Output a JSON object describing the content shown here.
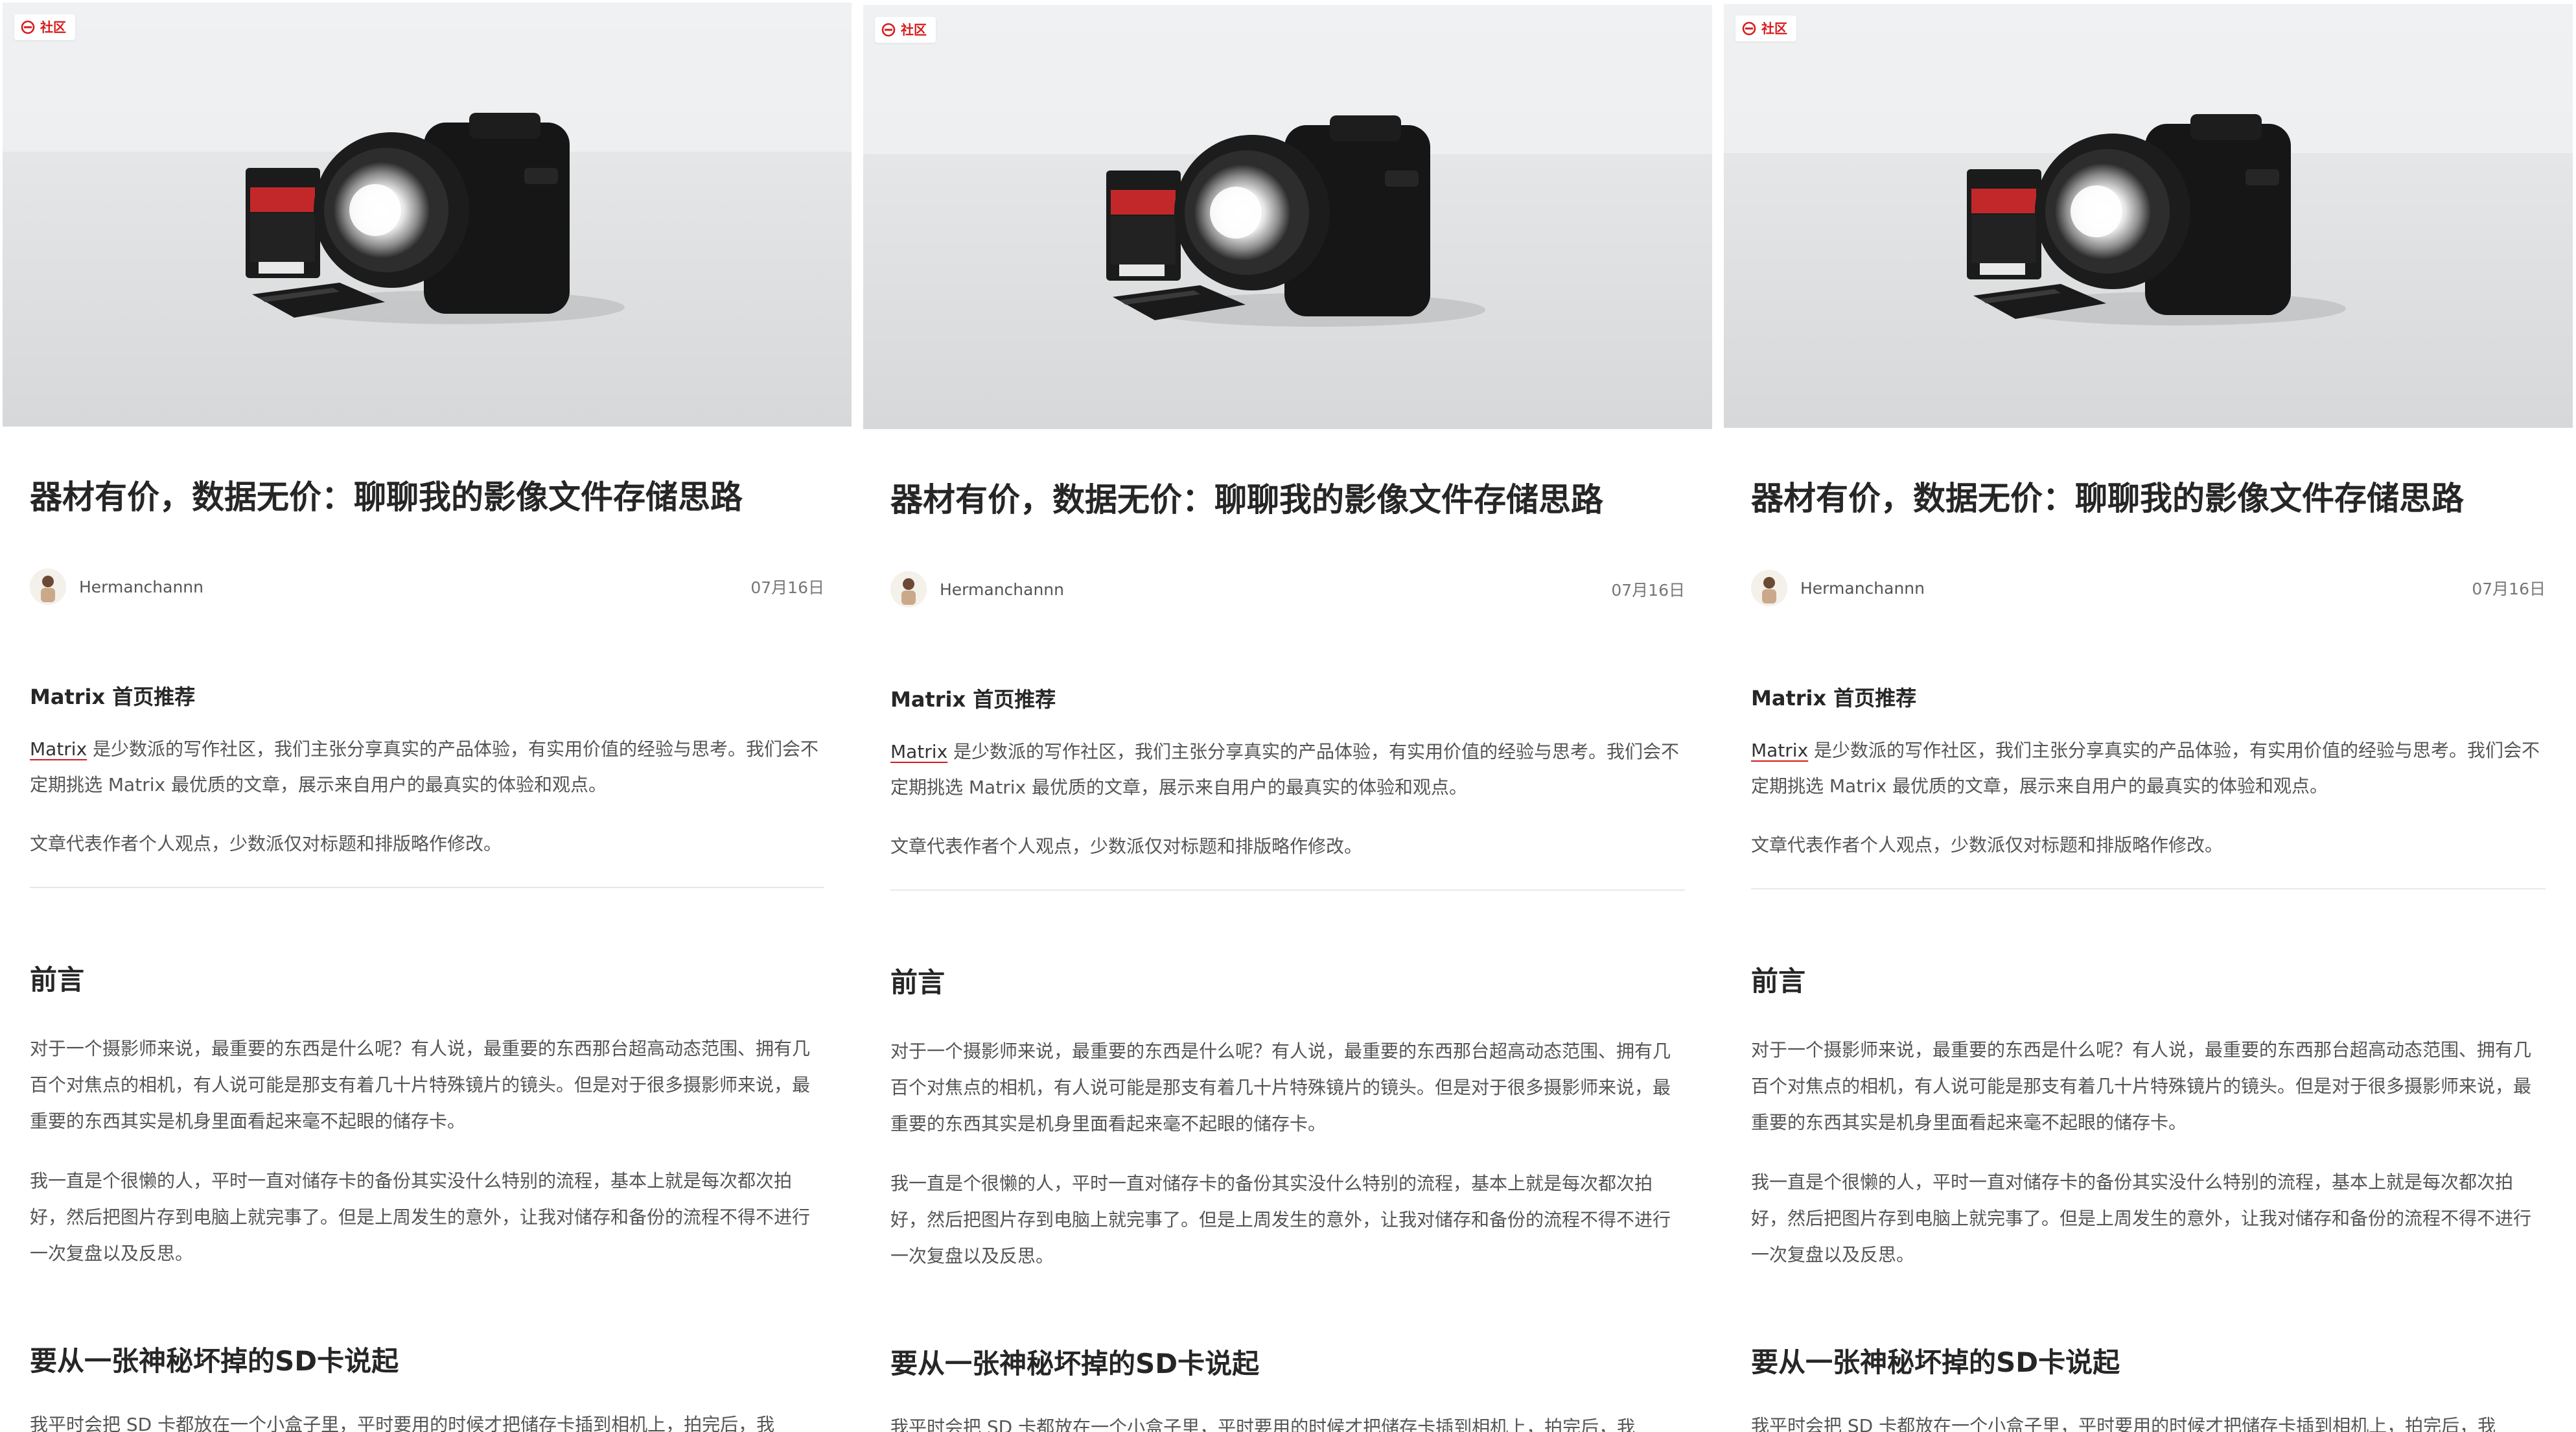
{
  "colors": {
    "accent": "#d71a1b",
    "text_dark": "#262626",
    "text_body": "#555555",
    "divider": "#e8e8e8"
  },
  "panels": [
    {
      "badge": "社区",
      "badge_icon": "sspai-logo-icon",
      "title": "器材有价，数据无价：聊聊我的影像文件存储思路",
      "author": "Hermanchannn",
      "date": "07月16日",
      "rec_heading": "Matrix 首页推荐",
      "rec_link": "Matrix",
      "rec_text": " 是少数派的写作社区，我们主张分享真实的产品体验，有实用价值的经验与思考。我们会不定期挑选 Matrix 最优质的文章，展示来自用户的最真实的体验和观点。",
      "rec_note": "文章代表作者个人观点，少数派仅对标题和排版略作修改。",
      "h2_preface": "前言",
      "para_1": "对于一个摄影师来说，最重要的东西是什么呢？有人说，最重要的东西那台超高动态范围、拥有几百个对焦点的相机，有人说可能是那支有着几十片特殊镜片的镜头。但是对于很多摄影师来说，最重要的东西其实是机身里面看起来毫不起眼的储存卡。",
      "para_2": "我一直是个很懒的人，平时一直对储存卡的备份其实没什么特别的流程，基本上就是每次都次拍好，然后把图片存到电脑上就完事了。但是上周发生的意外，让我对储存和备份的流程不得不进行一次复盘以及反思。",
      "h2_sd": "要从一张神秘坏掉的SD卡说起",
      "para_3": "我平时会把 SD 卡都放在一个小盒子里，平时要用的时候才把储存卡插到相机上，拍完后，我"
    },
    {
      "badge": "社区",
      "badge_icon": "sspai-logo-icon",
      "title": "器材有价，数据无价：聊聊我的影像文件存储思路",
      "author": "Hermanchannn",
      "date": "07月16日",
      "rec_heading": "Matrix 首页推荐",
      "rec_link": "Matrix",
      "rec_text": " 是少数派的写作社区，我们主张分享真实的产品体验，有实用价值的经验与思考。我们会不定期挑选 Matrix 最优质的文章，展示来自用户的最真实的体验和观点。",
      "rec_note": "文章代表作者个人观点，少数派仅对标题和排版略作修改。",
      "h2_preface": "前言",
      "para_1": "对于一个摄影师来说，最重要的东西是什么呢？有人说，最重要的东西那台超高动态范围、拥有几百个对焦点的相机，有人说可能是那支有着几十片特殊镜片的镜头。但是对于很多摄影师来说，最重要的东西其实是机身里面看起来毫不起眼的储存卡。",
      "para_2": "我一直是个很懒的人，平时一直对储存卡的备份其实没什么特别的流程，基本上就是每次都次拍好，然后把图片存到电脑上就完事了。但是上周发生的意外，让我对储存和备份的流程不得不进行一次复盘以及反思。",
      "h2_sd": "要从一张神秘坏掉的SD卡说起",
      "para_3": "我平时会把 SD 卡都放在一个小盒子里，平时要用的时候才把储存卡插到相机上，拍完后，我"
    },
    {
      "badge": "社区",
      "badge_icon": "sspai-logo-icon",
      "title": "器材有价，数据无价：聊聊我的影像文件存储思路",
      "author": "Hermanchannn",
      "date": "07月16日",
      "rec_heading": "Matrix 首页推荐",
      "rec_link": "Matrix",
      "rec_text": " 是少数派的写作社区，我们主张分享真实的产品体验，有实用价值的经验与思考。我们会不定期挑选 Matrix 最优质的文章，展示来自用户的最真实的体验和观点。",
      "rec_note": "文章代表作者个人观点，少数派仅对标题和排版略作修改。",
      "h2_preface": "前言",
      "para_1": "对于一个摄影师来说，最重要的东西是什么呢？有人说，最重要的东西那台超高动态范围、拥有几百个对焦点的相机，有人说可能是那支有着几十片特殊镜片的镜头。但是对于很多摄影师来说，最重要的东西其实是机身里面看起来毫不起眼的储存卡。",
      "para_2": "我一直是个很懒的人，平时一直对储存卡的备份其实没什么特别的流程，基本上就是每次都次拍好，然后把图片存到电脑上就完事了。但是上周发生的意外，让我对储存和备份的流程不得不进行一次复盘以及反思。",
      "h2_sd": "要从一张神秘坏掉的SD卡说起",
      "para_3": "我平时会把 SD 卡都放在一个小盒子里，平时要用的时候才把储存卡插到相机上，拍完后，我"
    }
  ]
}
